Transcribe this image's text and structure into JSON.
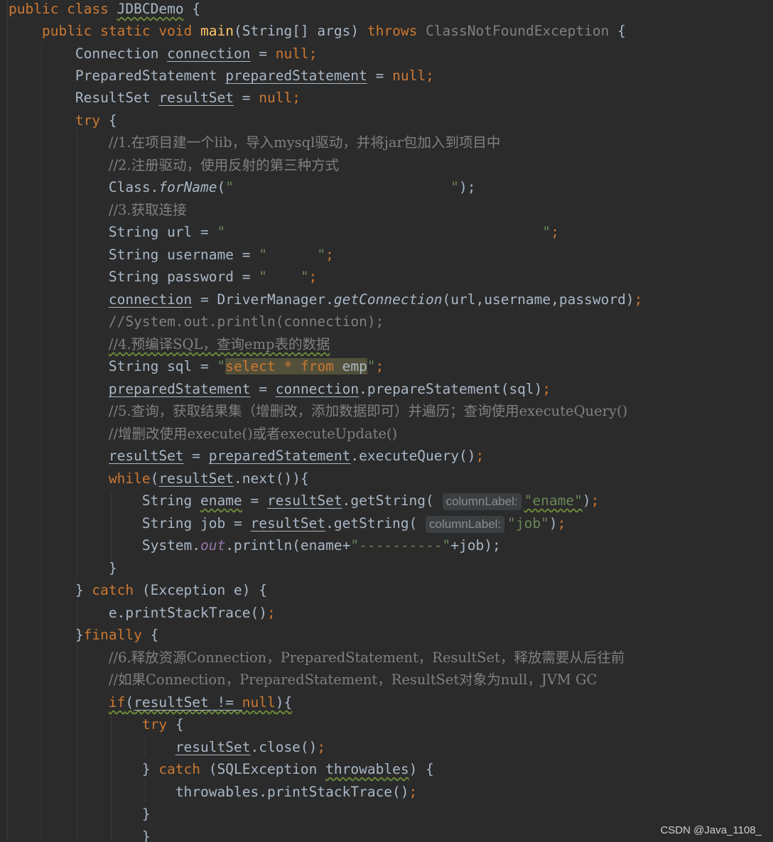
{
  "code": {
    "class_kw": "public class",
    "class_name": "JDBCDemo",
    "main_modifiers": "public static void",
    "main_name": "main",
    "main_params": "(String[] args)",
    "throws_kw": "throws",
    "exception_type": "ClassNotFoundException",
    "decl_connection_type": "Connection",
    "decl_connection_var": "connection",
    "decl_ps_type": "PreparedStatement",
    "decl_ps_var": "preparedStatement",
    "decl_rs_type": "ResultSet",
    "decl_rs_var": "resultSet",
    "null_kw": "null",
    "try_kw": "try",
    "comment_1": "//1.在项目建一个lib，导入mysql驱动，并将jar包加入到项目中",
    "comment_2": "//2.注册驱动，使用反射的第三种方式",
    "class_forname_obj": "Class.",
    "class_forname_method": "forName",
    "comment_3": "//3.获取连接",
    "url_decl": "String url = ",
    "username_decl": "String username = ",
    "password_decl": "String password = ",
    "get_connection_lhs": "connection",
    "driver_manager": "DriverManager.",
    "get_connection_method": "getConnection",
    "get_connection_args": "(url,username,password)",
    "comment_println": "//System.out.println(connection);",
    "comment_4": "//4.预编译SQL，查询emp表的数据",
    "sql_decl": "String sql = ",
    "sql_value": "select * from emp",
    "prepare_stmt_method": ".prepareStatement(sql)",
    "comment_5": "//5.查询，获取结果集（增删改，添加数据即可）并遍历；查询使用executeQuery()",
    "comment_5b": "//增删改使用execute()或者executeUpdate()",
    "execute_query": ".executeQuery()",
    "while_kw": "while",
    "next_call": ".next()){",
    "ename_decl": "String ",
    "ename_var": "ename",
    "get_string": ".getString(",
    "column_label_hint": "columnLabel:",
    "ename_str": "\"ename\"",
    "job_decl": "String job = ",
    "job_str": "\"job\"",
    "system_out": "System.",
    "out_field": "out",
    "println_call": ".println(ename+",
    "dash_str": "\"----------\"",
    "println_tail": "+job);",
    "catch_kw": "catch",
    "exception_param": "(Exception e) {",
    "print_stack": "e.printStackTrace()",
    "finally_kw": "finally",
    "comment_6": "//6.释放资源Connection，PreparedStatement，ResultSet，释放需要从后往前",
    "comment_6b": "//如果Connection，PreparedStatement，ResultSet对象为null，JVM GC",
    "if_kw": "if",
    "if_cond": "resultSet != ",
    "close_call": ".close()",
    "sql_exception_param": "(SQLException ",
    "throwables_var": "throwables",
    "throwables_print": "throwables.printStackTrace()"
  },
  "watermark": "CSDN @Java_1108_"
}
